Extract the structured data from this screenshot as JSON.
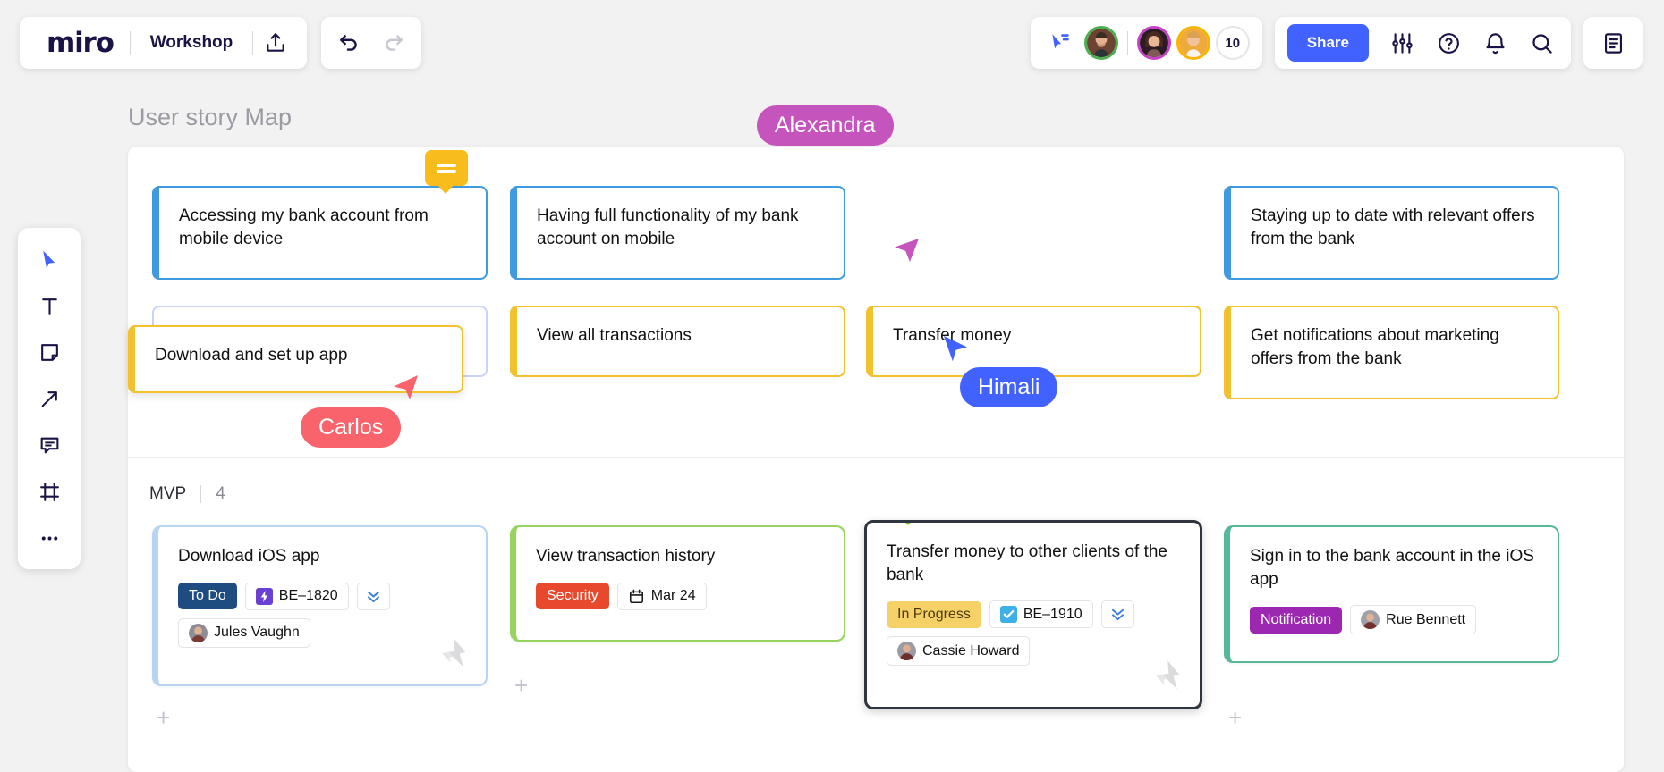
{
  "topbar": {
    "logo": "miro",
    "board_name": "Workshop",
    "share_label": "Share",
    "collaborator_count": "10",
    "icons": {
      "export": "upload-icon",
      "undo": "undo-icon",
      "redo": "redo-icon",
      "cursor_chat": "cursor-chat-icon",
      "settings": "sliders-icon",
      "help": "question-circle-icon",
      "notifications": "bell-icon",
      "search": "search-icon",
      "notes_panel": "document-icon"
    }
  },
  "left_toolbar": {
    "tools": [
      {
        "name": "select-tool",
        "icon": "cursor-icon"
      },
      {
        "name": "text-tool",
        "icon": "text-icon"
      },
      {
        "name": "sticky-note-tool",
        "icon": "sticky-note-icon"
      },
      {
        "name": "arrow-tool",
        "icon": "arrow-icon"
      },
      {
        "name": "comment-tool",
        "icon": "comment-icon"
      },
      {
        "name": "frame-tool",
        "icon": "frame-icon"
      },
      {
        "name": "more-tools",
        "icon": "ellipsis-icon"
      }
    ]
  },
  "board": {
    "title": "User story Map",
    "epics": [
      {
        "text": "Accessing my bank account from mobile device",
        "accent": "blue",
        "has_comment": true
      },
      {
        "text": "Having full functionality of my bank account on mobile",
        "accent": "blue",
        "has_comment": false
      },
      {
        "text": "Staying up to date with relevant offers from the bank",
        "accent": "blue",
        "has_comment": false
      }
    ],
    "activities": [
      {
        "text": "Download and set up app",
        "accent": "gold",
        "dragging": true
      },
      {
        "text": "View all transactions",
        "accent": "gold"
      },
      {
        "text": "Transfer money",
        "accent": "gold"
      },
      {
        "text": "Get notifications about marketing offers from the bank",
        "accent": "gold"
      }
    ],
    "release": {
      "label": "MVP",
      "count": "4"
    },
    "stories": [
      {
        "title": "Download iOS app",
        "style": "blue",
        "status": {
          "label": "To Do",
          "kind": "todo"
        },
        "ticket": {
          "id": "BE–1820",
          "icon": "jira-bolt-icon"
        },
        "priority_icon": "chevrons-down-icon",
        "assignee": "Jules Vaughn",
        "watermark": "jira-logo",
        "comment": null
      },
      {
        "title": "View transaction history",
        "style": "green",
        "status": {
          "label": "Security",
          "kind": "security"
        },
        "date": {
          "label": "Mar 24",
          "icon": "calendar-icon"
        },
        "comment": null
      },
      {
        "title": "Transfer money to other clients of the bank",
        "style": "selected",
        "status": {
          "label": "In Progress",
          "kind": "progress"
        },
        "ticket": {
          "id": "BE–1910",
          "icon": "check-square-icon"
        },
        "priority_icon": "chevrons-down-icon",
        "assignee": "Cassie Howard",
        "watermark": "jira-logo",
        "comment": "green"
      },
      {
        "title": "Sign in to the bank account in the iOS app",
        "style": "teal",
        "status": {
          "label": "Notification",
          "kind": "notification"
        },
        "assignee": "Rue Bennett",
        "comment": null
      }
    ],
    "add_buttons": [
      "+",
      "+",
      "+",
      "+"
    ]
  },
  "cursors": [
    {
      "name": "Alexandra",
      "color": "#c554bd"
    },
    {
      "name": "Himali",
      "color": "#4262ff"
    },
    {
      "name": "Carlos",
      "color": "#f9636b"
    }
  ]
}
